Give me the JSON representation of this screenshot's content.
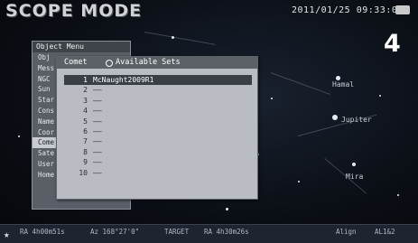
{
  "header": {
    "title": "SCOPE MODE",
    "datetime": "2011/01/25 09:33:00",
    "screen_number": "4"
  },
  "sky": {
    "labels": [
      "Hamal",
      "Jupiter",
      "Mira"
    ]
  },
  "object_menu": {
    "title": "Object Menu",
    "items": [
      "Obj",
      "Mess",
      "NGC",
      "Sun",
      "Star",
      "Cons",
      "Name",
      "Coor",
      "Come",
      "Sate",
      "User",
      "Home"
    ],
    "selected_index": 8
  },
  "comet_panel": {
    "title": "Comet",
    "sets_label": "Available Sets",
    "rows": [
      {
        "num": "1",
        "name": "McNaught2009R1"
      },
      {
        "num": "2",
        "name": "——"
      },
      {
        "num": "3",
        "name": "——"
      },
      {
        "num": "4",
        "name": "——"
      },
      {
        "num": "5",
        "name": "——"
      },
      {
        "num": "6",
        "name": "——"
      },
      {
        "num": "7",
        "name": "——"
      },
      {
        "num": "8",
        "name": "——"
      },
      {
        "num": "9",
        "name": "——"
      },
      {
        "num": "10",
        "name": "——"
      }
    ],
    "selected_index": 0
  },
  "statusbar": {
    "ra": "RA 4h00m51s",
    "az": "Az 168°27'0\"",
    "target": "TARGET",
    "target_ra": "RA 4h30m26s",
    "align": "Align",
    "align_val": "AL1&2"
  }
}
